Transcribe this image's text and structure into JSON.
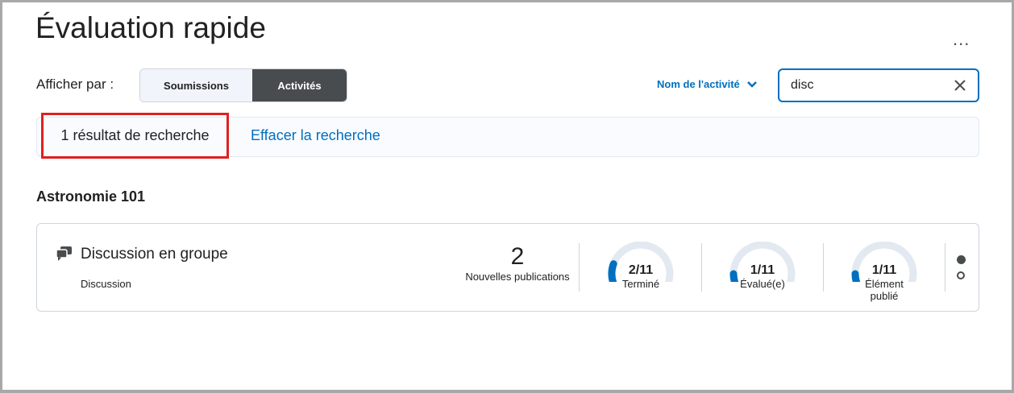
{
  "header": {
    "title": "Évaluation rapide",
    "more_label": "..."
  },
  "view": {
    "label": "Afficher par :",
    "options": [
      "Soumissions",
      "Activités"
    ],
    "selected": "Activités"
  },
  "sort": {
    "label": "Nom de l'activité"
  },
  "search": {
    "value": "disc"
  },
  "results": {
    "count_text": "1 résultat de recherche",
    "clear_label": "Effacer la recherche"
  },
  "course": {
    "name": "Astronomie 101"
  },
  "activity": {
    "name": "Discussion en groupe",
    "type": "Discussion",
    "new_posts": "2",
    "new_posts_label": "Nouvelles publications",
    "gauges": [
      {
        "value": "2/11",
        "label": "Terminé",
        "fraction": 0.1818
      },
      {
        "value": "1/11",
        "label": "Évalué(e)",
        "fraction": 0.0909
      },
      {
        "value": "1/11",
        "label": "Élément publié",
        "fraction": 0.0909
      }
    ]
  },
  "colors": {
    "accent": "#006fbf",
    "highlight": "#e0201f",
    "track": "#e3e9f1"
  }
}
